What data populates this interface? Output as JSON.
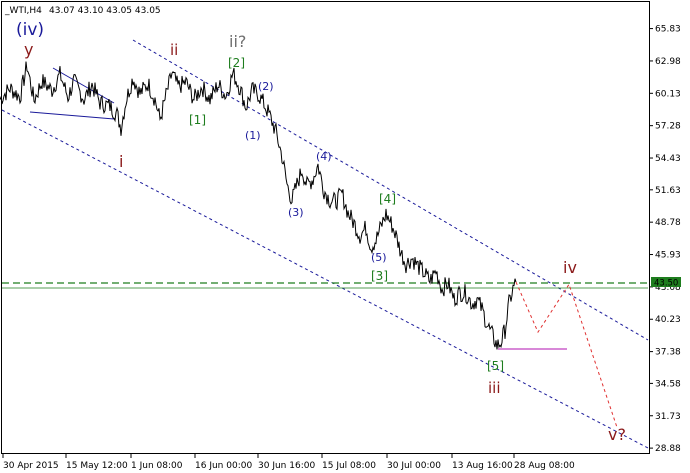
{
  "header": {
    "symbol": "_WTI,H4",
    "ohlc": "43.07 43.10 43.05 43.05"
  },
  "chart_data": {
    "type": "line",
    "ylim": [
      28.89,
      66.41
    ],
    "y_ticks": [
      65.83,
      62.98,
      60.13,
      57.28,
      54.43,
      51.63,
      48.78,
      45.93,
      43.08,
      40.23,
      37.38,
      34.58,
      31.73,
      28.88
    ],
    "x_ticks": [
      "30 Apr 2015",
      "15 May 12:00",
      "1 Jun 08:00",
      "16 Jun 00:00",
      "30 Jun 16:00",
      "15 Jul 08:00",
      "30 Jul 00:00",
      "13 Aug 16:00",
      "28 Aug 08:00"
    ],
    "grid": false,
    "current_price": "43.50",
    "current_price_colors": {
      "bg": "#1e7d1e",
      "text": "#ffffff"
    },
    "price_series": [
      [
        0,
        59.6
      ],
      [
        10,
        60.6
      ],
      [
        20,
        59.8
      ],
      [
        27,
        62.6
      ],
      [
        34,
        59.5
      ],
      [
        42,
        61.2
      ],
      [
        52,
        60.4
      ],
      [
        60,
        61.8
      ],
      [
        68,
        59.8
      ],
      [
        74,
        61.2
      ],
      [
        84,
        59.6
      ],
      [
        92,
        60.9
      ],
      [
        100,
        59.3
      ],
      [
        110,
        59.0
      ],
      [
        117,
        58.3
      ],
      [
        121,
        57.1
      ],
      [
        126,
        59.5
      ],
      [
        133,
        61.5
      ],
      [
        140,
        60.1
      ],
      [
        148,
        61.0
      ],
      [
        155,
        59.6
      ],
      [
        160,
        57.8
      ],
      [
        166,
        59.9
      ],
      [
        172,
        61.9
      ],
      [
        178,
        60.7
      ],
      [
        186,
        61.1
      ],
      [
        194,
        59.6
      ],
      [
        202,
        60.7
      ],
      [
        210,
        59.6
      ],
      [
        218,
        60.9
      ],
      [
        226,
        59.9
      ],
      [
        233,
        61.9
      ],
      [
        240,
        60.6
      ],
      [
        246,
        58.9
      ],
      [
        252,
        60.4
      ],
      [
        258,
        60.1
      ],
      [
        264,
        59.2
      ],
      [
        270,
        58.1
      ],
      [
        276,
        56.7
      ],
      [
        282,
        54.6
      ],
      [
        287,
        52.1
      ],
      [
        292,
        50.7
      ],
      [
        297,
        52.1
      ],
      [
        302,
        53.4
      ],
      [
        307,
        52.0
      ],
      [
        313,
        52.6
      ],
      [
        318,
        53.8
      ],
      [
        324,
        51.6
      ],
      [
        330,
        50.7
      ],
      [
        336,
        50.6
      ],
      [
        342,
        51.3
      ],
      [
        348,
        49.6
      ],
      [
        354,
        48.7
      ],
      [
        360,
        47.6
      ],
      [
        366,
        48.3
      ],
      [
        371,
        46.6
      ],
      [
        376,
        47.2
      ],
      [
        381,
        48.4
      ],
      [
        386,
        49.5
      ],
      [
        391,
        48.7
      ],
      [
        396,
        47.6
      ],
      [
        401,
        46.1
      ],
      [
        406,
        45.1
      ],
      [
        412,
        45.6
      ],
      [
        418,
        44.9
      ],
      [
        424,
        44.3
      ],
      [
        430,
        43.6
      ],
      [
        436,
        44.5
      ],
      [
        442,
        42.9
      ],
      [
        448,
        43.4
      ],
      [
        454,
        42.0
      ],
      [
        460,
        42.6
      ],
      [
        466,
        42.5
      ],
      [
        472,
        41.6
      ],
      [
        477,
        42.0
      ],
      [
        482,
        41.1
      ],
      [
        488,
        39.6
      ],
      [
        493,
        38.7
      ],
      [
        497,
        37.9
      ],
      [
        501,
        38.2
      ],
      [
        505,
        39.3
      ],
      [
        509,
        41.6
      ],
      [
        513,
        42.9
      ],
      [
        516,
        43.5
      ]
    ],
    "forecast": [
      [
        516,
        43.5
      ],
      [
        538,
        39.1
      ],
      [
        569,
        43.3
      ],
      [
        617,
        30.7
      ]
    ],
    "colors": {
      "price": "#000000",
      "channel": "#1a1a9a",
      "hline": "#1e7d1e",
      "forecast": "#e03030",
      "support": "#c040c0",
      "navy": "#1a1a9a",
      "dark_red": "#8b1a1a",
      "green": "#1e7d1e",
      "gray": "#707070"
    },
    "labels": {
      "iv_outer": "(iv)",
      "y": "y",
      "ii": "ii",
      "ii_q": "ii?",
      "b2": "[2]",
      "b1": "[1]",
      "p2": "(2)",
      "p1": "(1)",
      "i": "i",
      "p4": "(4)",
      "p3": "(3)",
      "b4": "[4]",
      "p5": "(5)",
      "b3": "[3]",
      "iv": "iv",
      "b5": "[5]",
      "iii": "iii",
      "v_q": "v?"
    }
  }
}
